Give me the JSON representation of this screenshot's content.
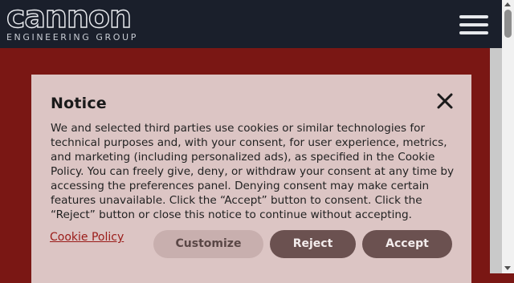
{
  "header": {
    "logo_text": "cannon",
    "logo_subtitle": "ENGINEERING GROUP",
    "menu_icon": "hamburger-menu-icon"
  },
  "notice": {
    "title": "Notice",
    "close_icon": "close-icon",
    "body": "We and selected third parties use cookies or similar technologies for technical purposes and, with your consent, for user experience, metrics, and marketing (including personalized ads), as specified in the Cookie Policy. You can freely give, deny, or withdraw your consent at any time by accessing the preferences panel. Denying consent may make certain features unavailable. Click the “Accept” button to consent. Click the “Reject” button or close this notice to continue without accepting.",
    "policy_link": "Cookie Policy",
    "buttons": {
      "customize": "Customize",
      "reject": "Reject",
      "accept": "Accept"
    }
  },
  "colors": {
    "header_bg": "#1a1f2b",
    "page_bg": "#7a1714",
    "notice_bg": "#dcc5c4",
    "button_dark": "#6b5150",
    "button_light": "#c8afae",
    "link": "#9a1b18"
  }
}
